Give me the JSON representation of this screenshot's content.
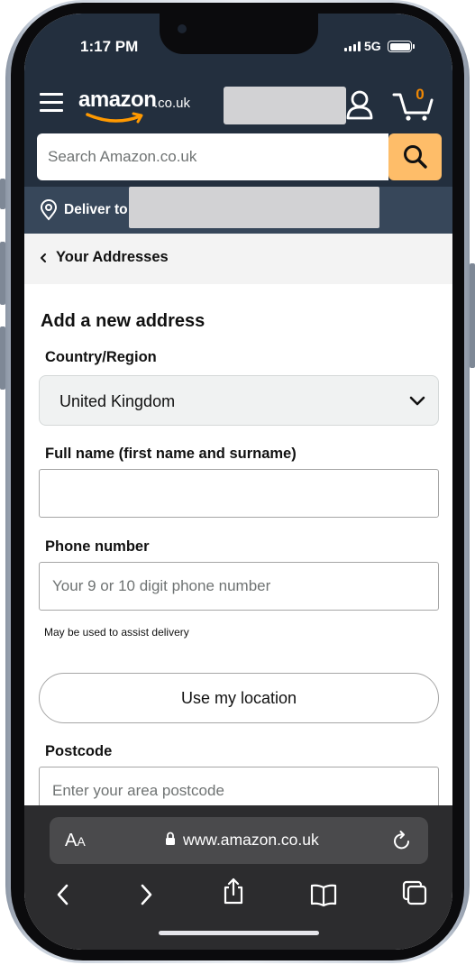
{
  "status_bar": {
    "time": "1:17 PM",
    "network": "5G"
  },
  "header": {
    "logo_main": "amazon",
    "logo_tld": ".co.uk",
    "cart_count": "0",
    "accent_color": "#febd69",
    "header_color": "#232f3e"
  },
  "search": {
    "placeholder": "Search Amazon.co.uk"
  },
  "deliver": {
    "label": "Deliver to"
  },
  "breadcrumb": {
    "label": "Your Addresses"
  },
  "form": {
    "title": "Add a new address",
    "country": {
      "label": "Country/Region",
      "value": "United Kingdom"
    },
    "full_name": {
      "label": "Full name (first name and surname)",
      "value": ""
    },
    "phone": {
      "label": "Phone number",
      "placeholder": "Your 9 or 10 digit phone number",
      "hint": "May be used to assist delivery"
    },
    "use_location_label": "Use my location",
    "postcode": {
      "label": "Postcode",
      "placeholder": "Enter your area postcode"
    }
  },
  "browser": {
    "aa_label": "A",
    "aa_small": "A",
    "url": "www.amazon.co.uk",
    "icons": [
      "back-icon",
      "forward-icon",
      "share-icon",
      "bookmarks-icon",
      "tabs-icon"
    ]
  }
}
